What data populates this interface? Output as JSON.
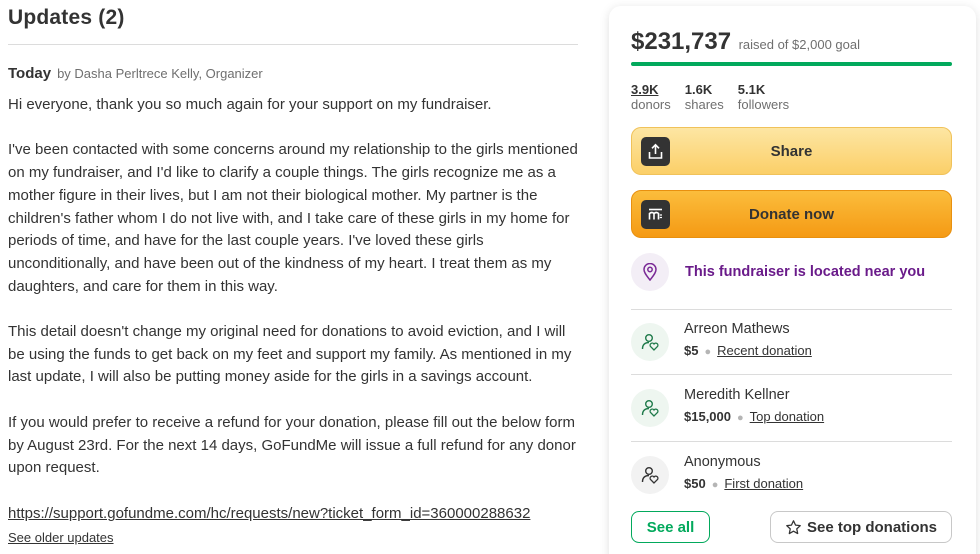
{
  "updates": {
    "title": "Updates (2)",
    "date": "Today",
    "byline": "by Dasha Perltrece Kelly, Organizer",
    "paragraphs": [
      "Hi everyone, thank you so much again for your support on my fundraiser.",
      "I've been contacted with some concerns around my relationship to the girls mentioned on my fundraiser, and I'd like to clarify a couple things. The girls recognize me as a mother figure in their lives, but I am not their biological mother. My partner is the children's father whom I do not live with, and I take care of these girls in my home for periods of time, and have for the last couple years. I've loved these girls unconditionally, and have been out of the kindness of my heart. I treat them as my daughters, and care for them in this way.",
      "This detail doesn't change my original need for donations to avoid eviction, and I will be using the funds to get back on my feet and support my family. As mentioned in my last update, I will also be putting money aside for the girls in a savings account.",
      "If you would prefer to receive a refund for your donation, please fill out the below form by August 23rd. For the next 14 days, GoFundMe will issue a full refund for any donor upon request."
    ],
    "link": "https://support.gofundme.com/hc/requests/new?ticket_form_id=360000288632",
    "older_link": "See older updates"
  },
  "summary": {
    "amount": "$231,737",
    "goal_text": "raised of $2,000 goal",
    "progress_fraction": 1.0,
    "stats": {
      "donors_num": "3.9K",
      "donors_label": "donors",
      "shares_num": "1.6K",
      "shares_label": "shares",
      "followers_num": "5.1K",
      "followers_label": "followers"
    },
    "share_label": "Share",
    "donate_label": "Donate now",
    "location_text": "This fundraiser is located near you"
  },
  "donations": [
    {
      "name": "Arreon Mathews",
      "amount": "$5",
      "tag": "Recent donation"
    },
    {
      "name": "Meredith Kellner",
      "amount": "$15,000",
      "tag": "Top donation"
    },
    {
      "name": "Anonymous",
      "amount": "$50",
      "tag": "First donation"
    }
  ],
  "buttons": {
    "see_all": "See all",
    "see_top": "See top donations"
  },
  "colors": {
    "accent_green": "#02a95c",
    "share_yellow": "#fbcf68",
    "donate_orange": "#f59a14",
    "location_purple": "#6a1b8a"
  },
  "icons": {
    "share": "share-icon",
    "donate": "gofundme-logo-icon",
    "location": "location-pin-icon",
    "donor": "donor-heart-icon",
    "star": "star-icon"
  }
}
